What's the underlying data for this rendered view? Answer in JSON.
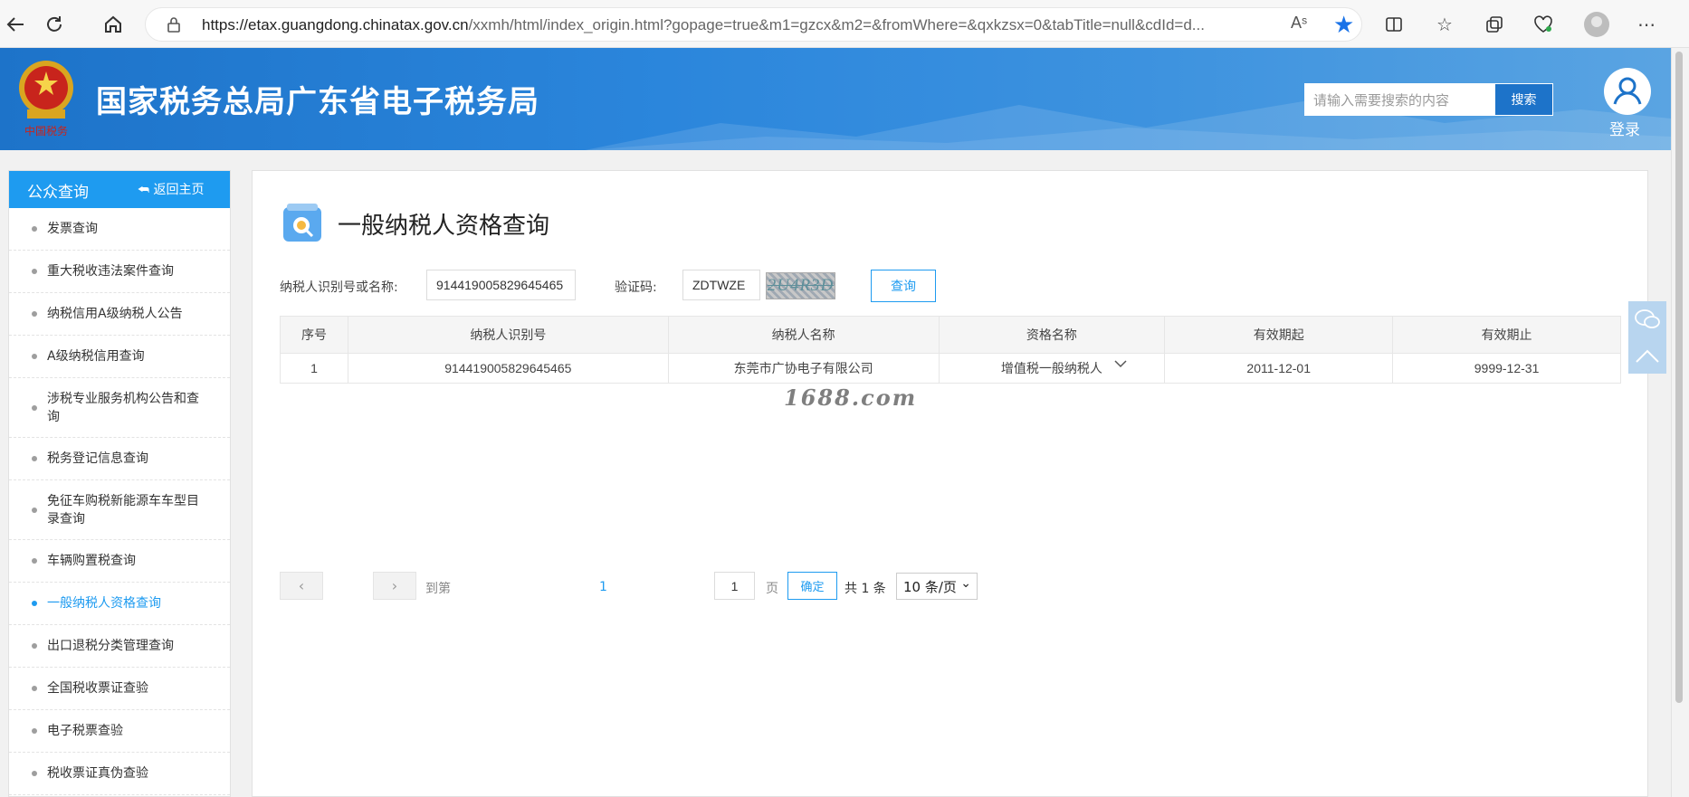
{
  "browser": {
    "url_host": "https://etax.guangdong.chinatax.gov.cn",
    "url_path": "/xxmh/html/index_origin.html?gopage=true&m1=gzcx&m2=&fromWhere=&qxkzsx=0&tabTitle=null&cdId=d...",
    "read_aloud": "Aˢ"
  },
  "header": {
    "site_title": "国家税务总局广东省电子税务局",
    "search_placeholder": "请输入需要搜索的内容",
    "search_button": "搜索",
    "login_label": "登录"
  },
  "sidebar": {
    "title": "公众查询",
    "back_label": "返回主页",
    "items": [
      {
        "label": "发票查询"
      },
      {
        "label": "重大税收违法案件查询"
      },
      {
        "label": "纳税信用A级纳税人公告"
      },
      {
        "label": "A级纳税信用查询"
      },
      {
        "label": "涉税专业服务机构公告和查询"
      },
      {
        "label": "税务登记信息查询"
      },
      {
        "label": "免征车购税新能源车车型目录查询"
      },
      {
        "label": "车辆购置税查询"
      },
      {
        "label": "一般纳税人资格查询"
      },
      {
        "label": "出口退税分类管理查询"
      },
      {
        "label": "全国税收票证查验"
      },
      {
        "label": "电子税票查验"
      },
      {
        "label": "税收票证真伪查验"
      }
    ]
  },
  "main": {
    "title": "一般纳税人资格查询",
    "form": {
      "id_label": "纳税人识别号或名称:",
      "id_value": "914419005829645465",
      "captcha_label": "验证码:",
      "captcha_value": "ZDTWZE",
      "captcha_image_text": "2U4R3D",
      "query_button": "查询"
    },
    "table": {
      "headers": [
        "序号",
        "纳税人识别号",
        "纳税人名称",
        "资格名称",
        "有效期起",
        "有效期止"
      ],
      "rows": [
        [
          "1",
          "914419005829645465",
          "东莞市广协电子有限公司",
          "增值税一般纳税人",
          "2011-12-01",
          "9999-12-31"
        ]
      ]
    },
    "pagination": {
      "current_page": "1",
      "goto_label": "到第",
      "page_input": "1",
      "page_label": "页",
      "confirm": "确定",
      "total": "共 1 条",
      "page_size": "10 条/页"
    },
    "watermark": "1688.com"
  }
}
